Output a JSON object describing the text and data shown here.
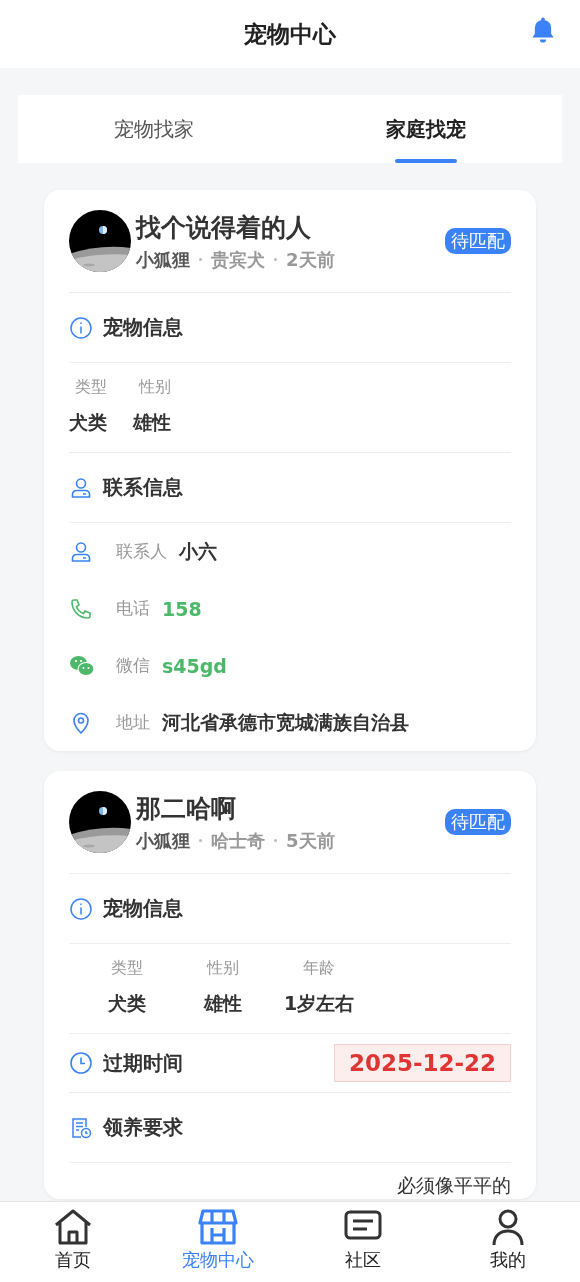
{
  "header": {
    "title": "宠物中心"
  },
  "tabs": [
    {
      "label": "宠物找家",
      "selected": false
    },
    {
      "label": "家庭找宠",
      "selected": true
    }
  ],
  "posts": [
    {
      "title": "找个说得着的人",
      "author": "小狐狸",
      "breed": "贵宾犬",
      "time": "2天前",
      "status": "待匹配",
      "sections": [
        {
          "kind": "attributes",
          "title": "宠物信息",
          "fields": [
            {
              "label": "类型",
              "value": "犬类"
            },
            {
              "label": "性别",
              "value": "雄性"
            }
          ]
        },
        {
          "kind": "contacts",
          "title": "联系信息",
          "rows": [
            {
              "kind": "person",
              "label": "联系人",
              "value": "小六"
            },
            {
              "kind": "phone",
              "label": "电话",
              "value": "158"
            },
            {
              "kind": "wechat",
              "label": "微信",
              "value": "s45gd"
            },
            {
              "kind": "location",
              "label": "地址",
              "value": "河北省承德市宽城满族自治县"
            }
          ]
        }
      ]
    },
    {
      "title": "那二哈啊",
      "author": "小狐狸",
      "breed": "哈士奇",
      "time": "5天前",
      "status": "待匹配",
      "sections": [
        {
          "kind": "attributes",
          "title": "宠物信息",
          "fields": [
            {
              "label": "类型",
              "value": "犬类"
            },
            {
              "label": "性别",
              "value": "雄性"
            },
            {
              "label": "年龄",
              "value": "1岁左右"
            }
          ]
        },
        {
          "kind": "expiry",
          "title": "过期时间",
          "value": "2025-12-22"
        },
        {
          "kind": "requirements",
          "title": "领养要求",
          "text": "必须像平平的"
        }
      ]
    }
  ],
  "nav": [
    {
      "kind": "home",
      "label": "首页",
      "selected": false
    },
    {
      "kind": "shop",
      "label": "宠物中心",
      "selected": true
    },
    {
      "kind": "community",
      "label": "社区",
      "selected": false
    },
    {
      "kind": "profile",
      "label": "我的",
      "selected": false
    }
  ]
}
